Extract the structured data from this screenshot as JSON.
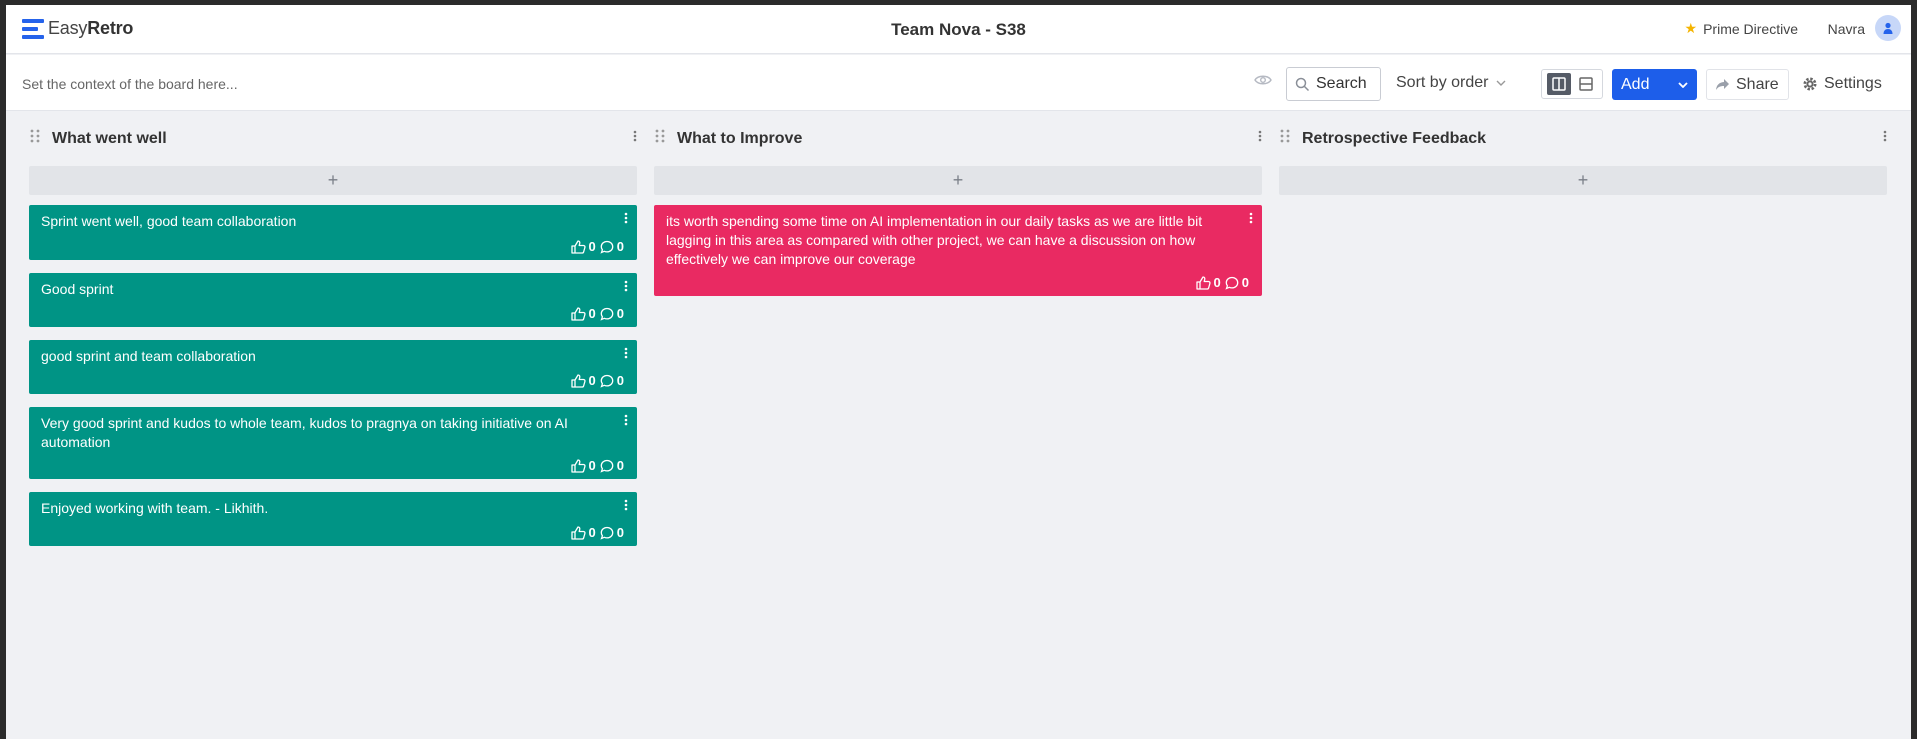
{
  "header": {
    "logo_light": "Easy",
    "logo_bold": "Retro",
    "board_title": "Team Nova - S38",
    "prime_directive": "Prime Directive",
    "user_name": "Navra"
  },
  "toolbar": {
    "context_placeholder": "Set the context of the board here...",
    "search_placeholder": "Search",
    "sort_label": "Sort by order",
    "add_label": "Add",
    "share_label": "Share",
    "settings_label": "Settings"
  },
  "colors": {
    "green_card": "#009485",
    "pink_card": "#e92a62",
    "accent": "#1d5eea"
  },
  "columns": [
    {
      "title": "What went well",
      "add_symbol": "+",
      "cards": [
        {
          "text": "Sprint went well, good team collaboration",
          "likes": "0",
          "comments": "0"
        },
        {
          "text": "Good sprint",
          "likes": "0",
          "comments": "0"
        },
        {
          "text": "good sprint and team collaboration",
          "likes": "0",
          "comments": "0"
        },
        {
          "text": "Very good sprint and kudos to whole team, kudos to pragnya on taking initiative on AI automation",
          "likes": "0",
          "comments": "0"
        },
        {
          "text": "Enjoyed working with team. - Likhith.",
          "likes": "0",
          "comments": "0"
        }
      ]
    },
    {
      "title": "What to Improve",
      "add_symbol": "+",
      "cards": [
        {
          "text": "its worth spending some time on AI implementation in our daily tasks as we are little bit lagging in this area as compared with other project, we can have a discussion on how effectively we can improve our coverage",
          "likes": "0",
          "comments": "0"
        }
      ]
    },
    {
      "title": "Retrospective Feedback",
      "add_symbol": "+",
      "cards": []
    }
  ]
}
